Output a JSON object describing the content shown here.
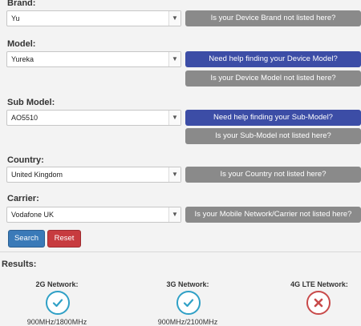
{
  "form": {
    "brand": {
      "label": "Brand:",
      "value": "Yu",
      "not_listed": "Is your Device Brand not listed here?"
    },
    "model": {
      "label": "Model:",
      "value": "Yureka",
      "help": "Need help finding your Device Model?",
      "not_listed": "Is your Device Model not listed here?"
    },
    "submodel": {
      "label": "Sub Model:",
      "value": "AO5510",
      "help": "Need help finding your Sub-Model?",
      "not_listed": "Is your Sub-Model not listed here?"
    },
    "country": {
      "label": "Country:",
      "value": "United Kingdom",
      "not_listed": "Is your Country not listed here?"
    },
    "carrier": {
      "label": "Carrier:",
      "value": "Vodafone UK",
      "not_listed": "Is your Mobile Network/Carrier not listed here?"
    },
    "search_label": "Search",
    "reset_label": "Reset"
  },
  "results": {
    "title": "Results:",
    "networks": [
      {
        "name": "2G Network:",
        "status": "supported",
        "icon": "check-icon",
        "freq": "900MHz/1800MHz"
      },
      {
        "name": "3G Network:",
        "status": "supported",
        "icon": "check-icon",
        "freq": "900MHz/2100MHz"
      },
      {
        "name": "4G LTE Network:",
        "status": "not-supported",
        "icon": "cross-icon",
        "freq": ""
      }
    ]
  },
  "colors": {
    "primary_blue": "#3c4da6",
    "gray_button": "#8a8a8a",
    "reset_red": "#c73b3f",
    "check": "#2fa0c6",
    "cross": "#c84a4a"
  }
}
